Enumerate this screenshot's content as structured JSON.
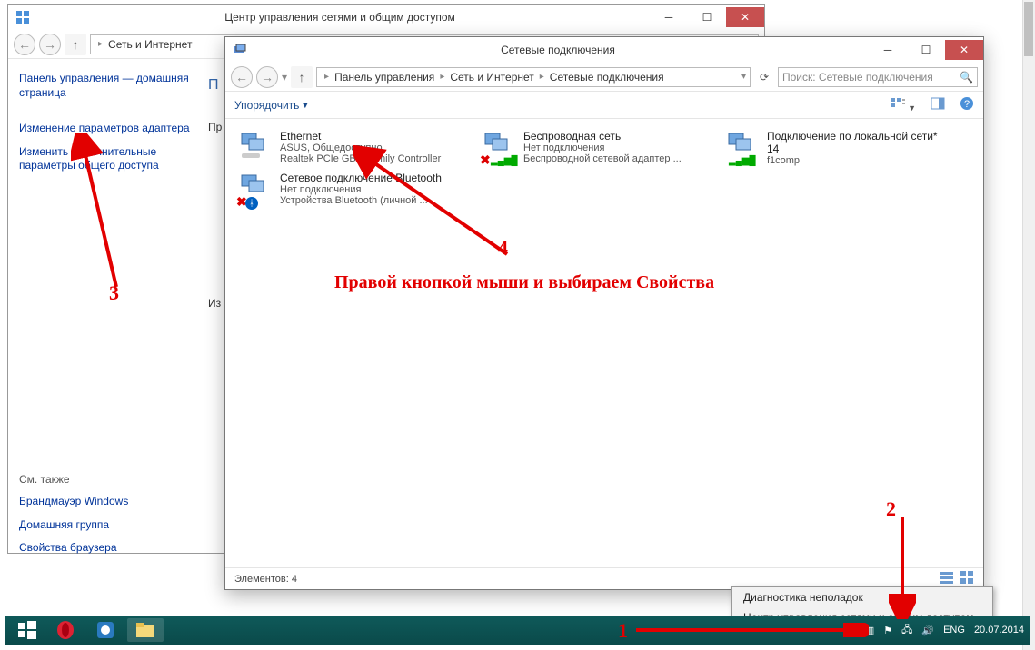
{
  "back_window": {
    "title": "Центр управления сетями и общим доступом",
    "breadcrumb": [
      "Сеть и Интернет"
    ],
    "sidebar": {
      "link_home": "Панель управления — домашняя страница",
      "link_adapter": "Изменение параметров адаптера",
      "link_shared": "Изменить дополнительные параметры общего доступа",
      "see_also": "См. также",
      "link_firewall": "Брандмауэр Windows",
      "link_homegroup": "Домашняя группа",
      "link_browser": "Свойства браузера"
    },
    "main": {
      "h1": "П",
      "h2": "Пр",
      "h3": "Из"
    }
  },
  "front_window": {
    "title": "Сетевые подключения",
    "breadcrumb": [
      "Панель управления",
      "Сеть и Интернет",
      "Сетевые подключения"
    ],
    "search_placeholder": "Поиск: Сетевые подключения",
    "toolbar_organize": "Упорядочить",
    "connections": [
      {
        "name": "Ethernet",
        "status": "ASUS, Общедоступно",
        "device": "Realtek PCIe GBE Family Controller",
        "overlay": "none"
      },
      {
        "name": "Беспроводная сеть",
        "status": "Нет подключения",
        "device": "Беспроводной сетевой адаптер ...",
        "overlay": "x-bars"
      },
      {
        "name": "Подключение по локальной сети* 14",
        "status": "",
        "device": "f1comp",
        "overlay": "bars"
      },
      {
        "name": "Сетевое подключение Bluetooth",
        "status": "Нет подключения",
        "device": "Устройства Bluetooth (личной ...",
        "overlay": "x-bt"
      }
    ],
    "status_count": "Элементов: 4"
  },
  "context_menu": {
    "item1": "Диагностика неполадок",
    "item2": "Центр управления сетями и общим доступом"
  },
  "taskbar": {
    "lang": "ENG",
    "date": "20.07.2014"
  },
  "annotations": {
    "n1": "1",
    "n2": "2",
    "n3": "3",
    "n4": "4",
    "hint": "Правой кнопкой мыши и выбираем Свойства"
  }
}
